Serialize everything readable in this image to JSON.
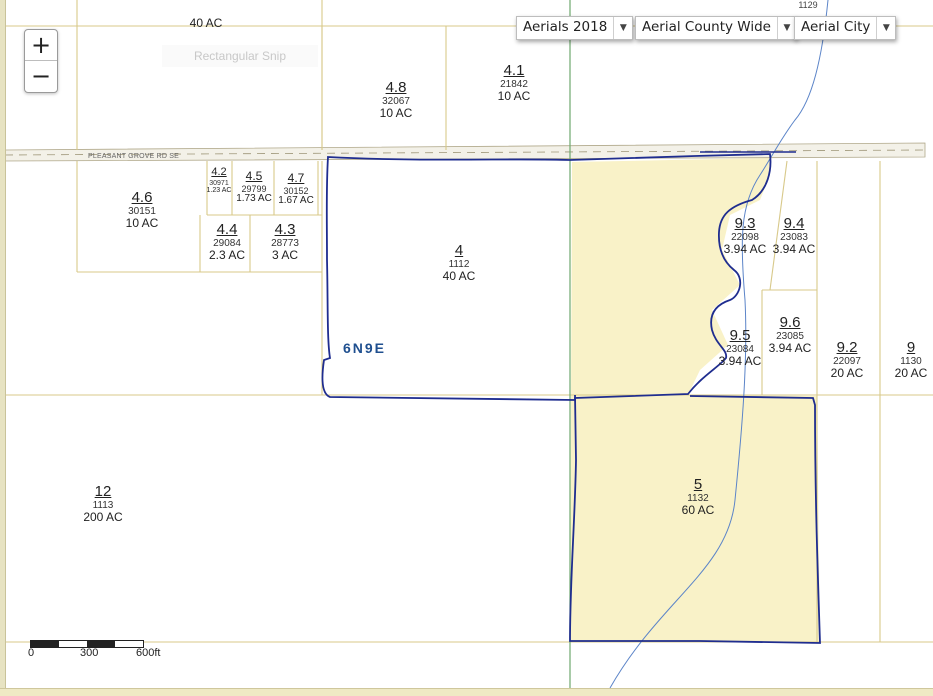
{
  "toolbar": {
    "partial_label": "40 AC"
  },
  "zoom": {
    "in_label": "+",
    "out_label": "−"
  },
  "layers": [
    {
      "label": "Aerials 2018"
    },
    {
      "label": "Aerial County Wide"
    },
    {
      "label": "Aerial City"
    }
  ],
  "snip_label": "Rectangular Snip",
  "road_label": "PLEASANT GROVE RD SE",
  "township_label": "6N9E",
  "top_edge_label": "1129",
  "parcels": [
    {
      "num": "4.8",
      "id": "32067",
      "acres": "10 AC"
    },
    {
      "num": "4.1",
      "id": "21842",
      "acres": "10 AC"
    },
    {
      "num": "4.6",
      "id": "30151",
      "acres": "10 AC"
    },
    {
      "num": "4.2",
      "id": "30971",
      "acres": "1.23 AC"
    },
    {
      "num": "4.5",
      "id": "29799",
      "acres": "1.73 AC"
    },
    {
      "num": "4.7",
      "id": "30152",
      "acres": "1.67 AC"
    },
    {
      "num": "4.4",
      "id": "29084",
      "acres": "2.3 AC"
    },
    {
      "num": "4.3",
      "id": "28773",
      "acres": "3 AC"
    },
    {
      "num": "4",
      "id": "1112",
      "acres": "40 AC"
    },
    {
      "num": "9.3",
      "id": "22098",
      "acres": "3.94 AC"
    },
    {
      "num": "9.4",
      "id": "23083",
      "acres": "3.94 AC"
    },
    {
      "num": "9.5",
      "id": "23084",
      "acres": "3.94 AC"
    },
    {
      "num": "9.6",
      "id": "23085",
      "acres": "3.94 AC"
    },
    {
      "num": "9.2",
      "id": "22097",
      "acres": "20 AC"
    },
    {
      "num": "9",
      "id": "1130",
      "acres": "20 AC"
    },
    {
      "num": "12",
      "id": "1113",
      "acres": "200 AC"
    },
    {
      "num": "5",
      "id": "1132",
      "acres": "60 AC"
    }
  ],
  "scale": {
    "t0": "0",
    "t1": "300",
    "t2": "600ft"
  },
  "colors": {
    "parcel_line": "#d8c98a",
    "highlight_fill": "#f9f2c8",
    "outline": "#1f2d8f",
    "stream": "#5b84c8",
    "section_line": "#6fa86f"
  }
}
